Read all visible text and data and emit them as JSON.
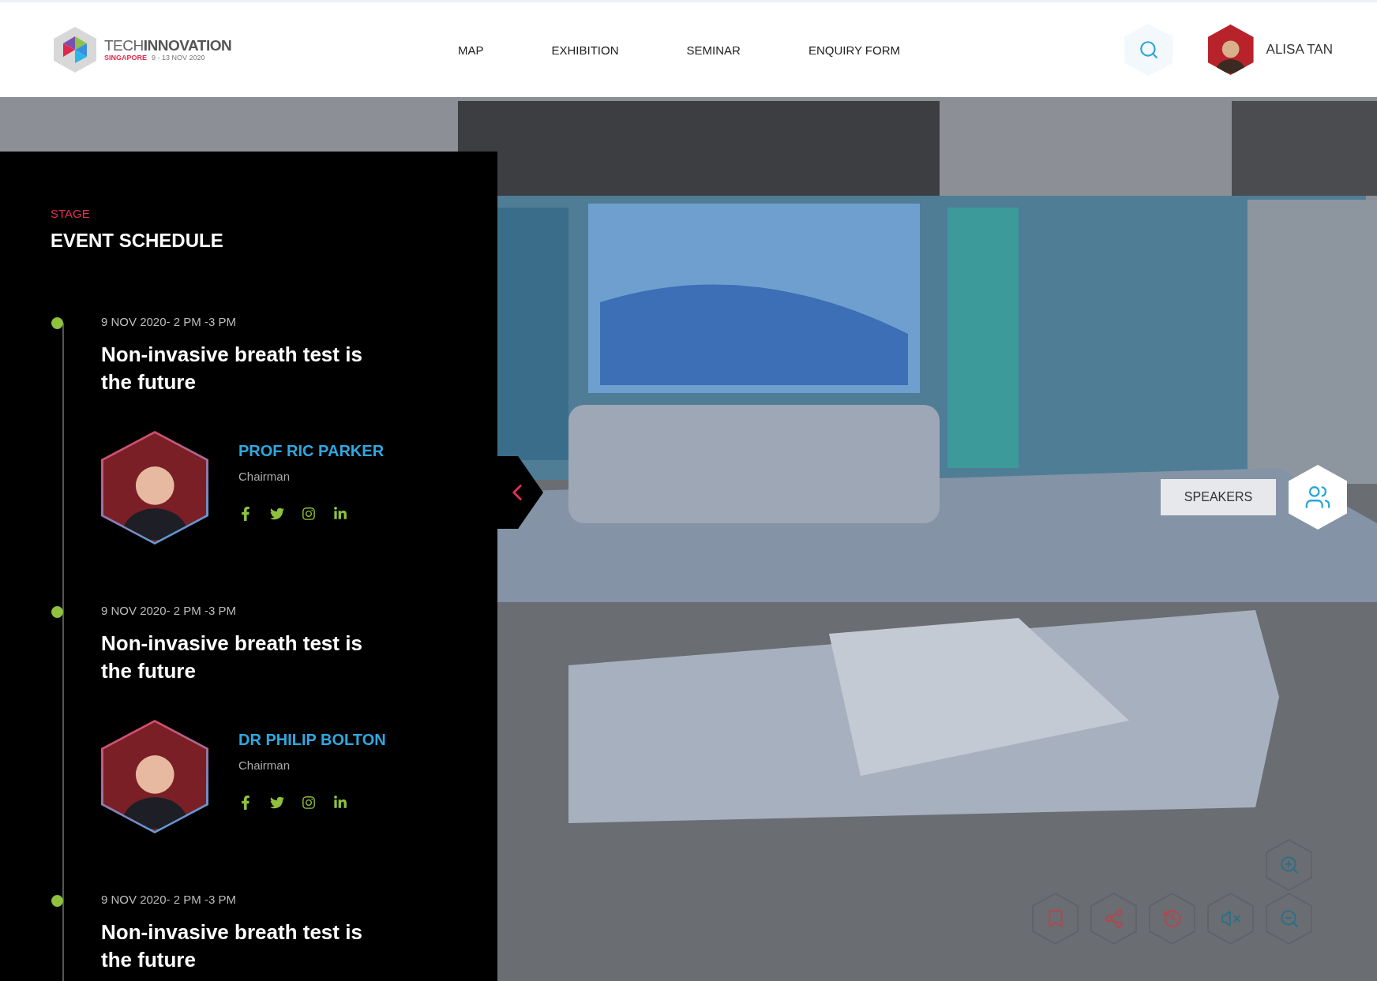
{
  "header": {
    "logo": {
      "title": "TECH**INNOVATION**",
      "location": "SINGAPORE",
      "dates": "9 - 13 NOV 2020"
    },
    "nav": [
      {
        "label": "MAP"
      },
      {
        "label": "EXHIBITION"
      },
      {
        "label": "SEMINAR"
      },
      {
        "label": "ENQUIRY FORM"
      }
    ],
    "user": {
      "name": "ALISA TAN"
    }
  },
  "schedule": {
    "eyebrow": "STAGE",
    "title": "EVENT SCHEDULE",
    "events": [
      {
        "date": "9 NOV 2020- 2 PM -3 PM",
        "title": "Non-invasive breath test is the future",
        "speaker": {
          "name": "PROF RIC PARKER",
          "role": "Chairman",
          "socials": [
            {
              "kind": "facebook"
            },
            {
              "kind": "twitter"
            },
            {
              "kind": "instagram"
            },
            {
              "kind": "linkedin"
            }
          ]
        }
      },
      {
        "date": "9 NOV 2020- 2 PM -3 PM",
        "title": "Non-invasive breath test is the future",
        "speaker": {
          "name": "DR PHILIP BOLTON",
          "role": "Chairman",
          "socials": [
            {
              "kind": "facebook"
            },
            {
              "kind": "twitter"
            },
            {
              "kind": "instagram"
            },
            {
              "kind": "linkedin"
            }
          ]
        }
      },
      {
        "date": "9 NOV 2020- 2 PM -3 PM",
        "title": "Non-invasive breath test is the future"
      }
    ]
  },
  "stage": {
    "speakers_label": "SPEAKERS",
    "controls": [
      {
        "kind": "bookmark"
      },
      {
        "kind": "share"
      },
      {
        "kind": "history"
      },
      {
        "kind": "mute"
      },
      {
        "kind": "zoom-out"
      }
    ],
    "zoom": {
      "kind": "zoom-in"
    }
  }
}
